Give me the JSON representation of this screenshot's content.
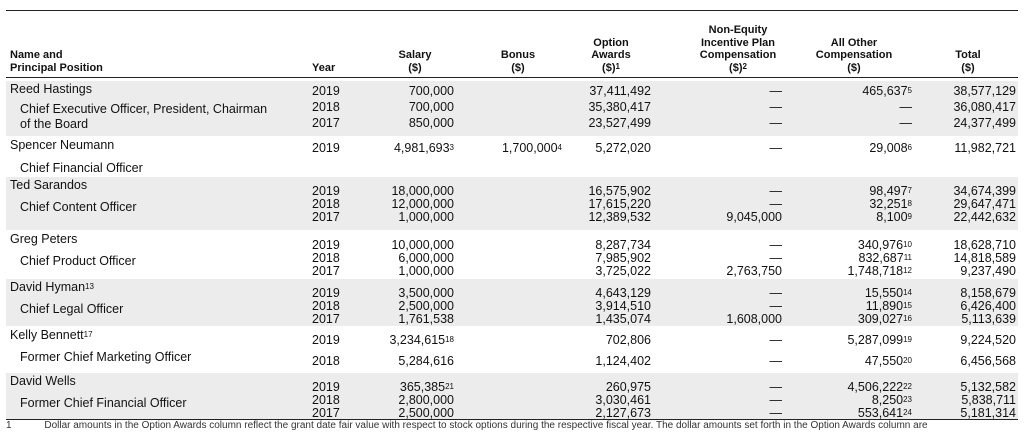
{
  "headers": {
    "name": "Name and\nPrincipal Position",
    "year": "Year",
    "salary": "Salary\n($)",
    "bonus": "Bonus\n($)",
    "option": "Option\nAwards\n($)",
    "option_sup": "1",
    "nonequity": "Non-Equity\nIncentive Plan\nCompensation\n($)",
    "nonequity_sup": "2",
    "other": "All Other\nCompensation\n($)",
    "total": "Total\n($)"
  },
  "officers": [
    {
      "name": "Reed Hastings",
      "name_sup": "",
      "title": "Chief Executive Officer, President, Chairman\nof the Board",
      "rows": [
        {
          "year": "2019",
          "salary": "700,000",
          "salary_sup": "",
          "bonus": "",
          "bonus_sup": "",
          "option": "37,411,492",
          "nonequity": "—",
          "other": "465,637",
          "other_sup": "5",
          "total": "38,577,129"
        },
        {
          "year": "2018",
          "salary": "700,000",
          "salary_sup": "",
          "bonus": "",
          "bonus_sup": "",
          "option": "35,380,417",
          "nonequity": "—",
          "other": "—",
          "other_sup": "",
          "total": "36,080,417"
        },
        {
          "year": "2017",
          "salary": "850,000",
          "salary_sup": "",
          "bonus": "",
          "bonus_sup": "",
          "option": "23,527,499",
          "nonequity": "—",
          "other": "—",
          "other_sup": "",
          "total": "24,377,499"
        }
      ]
    },
    {
      "name": "Spencer Neumann",
      "name_sup": "",
      "title": "Chief Financial Officer",
      "rows": [
        {
          "year": "2019",
          "salary": "4,981,693",
          "salary_sup": "3",
          "bonus": "1,700,000",
          "bonus_sup": "4",
          "option": "5,272,020",
          "nonequity": "—",
          "other": "29,008",
          "other_sup": "6",
          "total": "11,982,721"
        }
      ]
    },
    {
      "name": "Ted Sarandos",
      "name_sup": "",
      "title": "Chief Content Officer",
      "rows": [
        {
          "year": "2019",
          "salary": "18,000,000",
          "salary_sup": "",
          "bonus": "",
          "bonus_sup": "",
          "option": "16,575,902",
          "nonequity": "—",
          "other": "98,497",
          "other_sup": "7",
          "total": "34,674,399"
        },
        {
          "year": "2018",
          "salary": "12,000,000",
          "salary_sup": "",
          "bonus": "",
          "bonus_sup": "",
          "option": "17,615,220",
          "nonequity": "—",
          "other": "32,251",
          "other_sup": "8",
          "total": "29,647,471"
        },
        {
          "year": "2017",
          "salary": "1,000,000",
          "salary_sup": "",
          "bonus": "",
          "bonus_sup": "",
          "option": "12,389,532",
          "nonequity": "9,045,000",
          "other": "8,100",
          "other_sup": "9",
          "total": "22,442,632"
        }
      ]
    },
    {
      "name": "Greg Peters",
      "name_sup": "",
      "title": "Chief Product Officer",
      "rows": [
        {
          "year": "2019",
          "salary": "10,000,000",
          "salary_sup": "",
          "bonus": "",
          "bonus_sup": "",
          "option": "8,287,734",
          "nonequity": "—",
          "other": "340,976",
          "other_sup": "10",
          "total": "18,628,710"
        },
        {
          "year": "2018",
          "salary": "6,000,000",
          "salary_sup": "",
          "bonus": "",
          "bonus_sup": "",
          "option": "7,985,902",
          "nonequity": "—",
          "other": "832,687",
          "other_sup": "11",
          "total": "14,818,589"
        },
        {
          "year": "2017",
          "salary": "1,000,000",
          "salary_sup": "",
          "bonus": "",
          "bonus_sup": "",
          "option": "3,725,022",
          "nonequity": "2,763,750",
          "other": "1,748,718",
          "other_sup": "12",
          "total": "9,237,490"
        }
      ]
    },
    {
      "name": "David Hyman",
      "name_sup": "13",
      "title": "Chief Legal Officer",
      "rows": [
        {
          "year": "2019",
          "salary": "3,500,000",
          "salary_sup": "",
          "bonus": "",
          "bonus_sup": "",
          "option": "4,643,129",
          "nonequity": "—",
          "other": "15,550",
          "other_sup": "14",
          "total": "8,158,679"
        },
        {
          "year": "2018",
          "salary": "2,500,000",
          "salary_sup": "",
          "bonus": "",
          "bonus_sup": "",
          "option": "3,914,510",
          "nonequity": "—",
          "other": "11,890",
          "other_sup": "15",
          "total": "6,426,400"
        },
        {
          "year": "2017",
          "salary": "1,761,538",
          "salary_sup": "",
          "bonus": "",
          "bonus_sup": "",
          "option": "1,435,074",
          "nonequity": "1,608,000",
          "other": "309,027",
          "other_sup": "16",
          "total": "5,113,639"
        }
      ]
    },
    {
      "name": "Kelly Bennett",
      "name_sup": "17",
      "title": "Former Chief Marketing Officer",
      "rows": [
        {
          "year": "2019",
          "salary": "3,234,615",
          "salary_sup": "18",
          "bonus": "",
          "bonus_sup": "",
          "option": "702,806",
          "nonequity": "—",
          "other": "5,287,099",
          "other_sup": "19",
          "total": "9,224,520"
        },
        {
          "year": "2018",
          "salary": "5,284,616",
          "salary_sup": "",
          "bonus": "",
          "bonus_sup": "",
          "option": "1,124,402",
          "nonequity": "—",
          "other": "47,550",
          "other_sup": "20",
          "total": "6,456,568"
        }
      ]
    },
    {
      "name": "David Wells",
      "name_sup": "",
      "title": "Former Chief Financial Officer",
      "rows": [
        {
          "year": "2019",
          "salary": "365,385",
          "salary_sup": "21",
          "bonus": "",
          "bonus_sup": "",
          "option": "260,975",
          "nonequity": "—",
          "other": "4,506,222",
          "other_sup": "22",
          "total": "5,132,582"
        },
        {
          "year": "2018",
          "salary": "2,800,000",
          "salary_sup": "",
          "bonus": "",
          "bonus_sup": "",
          "option": "3,030,461",
          "nonequity": "—",
          "other": "8,250",
          "other_sup": "23",
          "total": "5,838,711"
        },
        {
          "year": "2017",
          "salary": "2,500,000",
          "salary_sup": "",
          "bonus": "",
          "bonus_sup": "",
          "option": "2,127,673",
          "nonequity": "—",
          "other": "553,641",
          "other_sup": "24",
          "total": "5,181,314"
        }
      ]
    }
  ],
  "footnote": {
    "marker": "1",
    "text": "Dollar amounts in the Option Awards column reflect the grant date fair value with respect to stock options during the respective fiscal year. The dollar amounts set forth in the Option Awards column are"
  }
}
